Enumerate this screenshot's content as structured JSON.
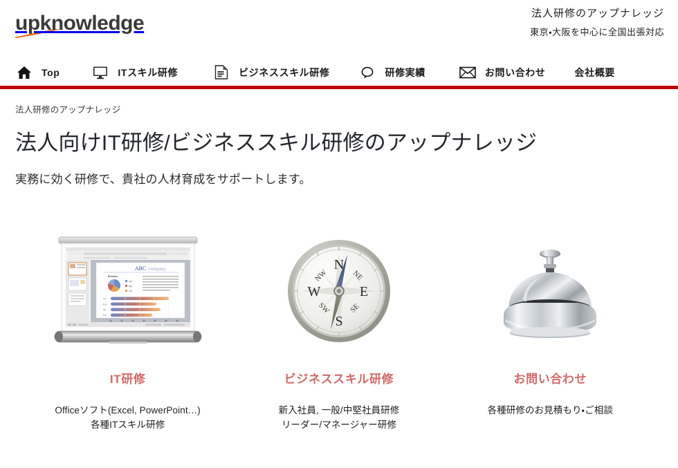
{
  "brand": {
    "logo_text": "upknowledge",
    "logo_color": "#3a3a3a",
    "swoosh_color": "#e8701a",
    "accent_color": "#c00810",
    "card_title_color": "#cf6a6a"
  },
  "header": {
    "tagline_main": "法人研修のアップナレッジ",
    "tagline_sub": "東京・大阪を中心に全国出張対応"
  },
  "nav": {
    "items": [
      {
        "label": "Top",
        "icon": "home-icon"
      },
      {
        "label": "ITスキル研修",
        "icon": "monitor-icon"
      },
      {
        "label": "ビジネススキル研修",
        "icon": "document-icon"
      },
      {
        "label": "研修実績",
        "icon": "speech-bubble-icon"
      },
      {
        "label": "お問い合わせ",
        "icon": "envelope-icon"
      },
      {
        "label": "会社概要",
        "icon": "none"
      }
    ]
  },
  "main": {
    "breadcrumb": "法人研修のアップナレッジ",
    "title": "法人向けIT研修/ビジネススキル研修のアップナレッジ",
    "subtitle": "実務に効く研修で、貴社の人材育成をサポートします。"
  },
  "cards": [
    {
      "image": "projector-screen-presentation-image",
      "image_caption": "ABC company",
      "title": "IT研修",
      "desc_line1": "Officeソフト(Excel, PowerPoint…)",
      "desc_line2": "各種ITスキル研修"
    },
    {
      "image": "compass-image",
      "image_caption": "N NE E SE S SW W NW",
      "title": "ビジネススキル研修",
      "desc_line1": "新入社員, 一般/中堅社員研修",
      "desc_line2": "リーダー/マネージャー研修"
    },
    {
      "image": "service-bell-image",
      "image_caption": "",
      "title": "お問い合わせ",
      "desc_line1": "各種研修のお見積もり・ご相談",
      "desc_line2": ""
    }
  ]
}
